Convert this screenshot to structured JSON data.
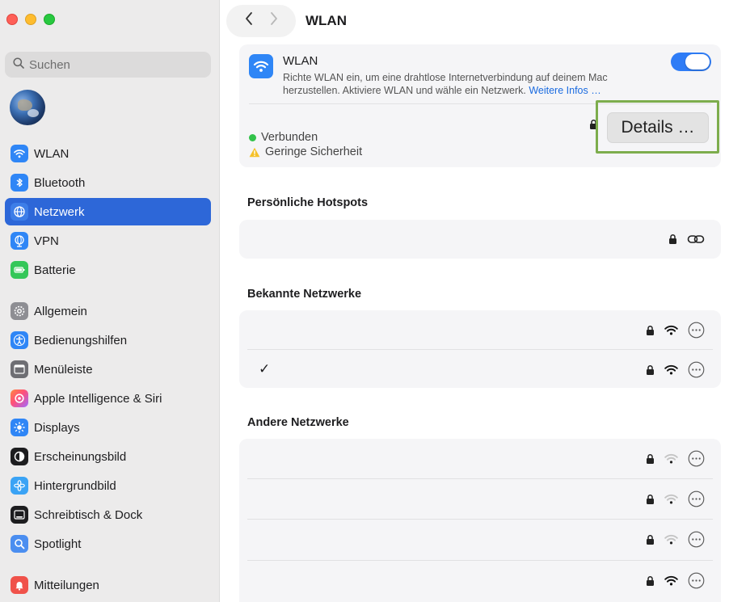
{
  "window": {
    "title": "WLAN"
  },
  "search": {
    "placeholder": "Suchen"
  },
  "sidebar": {
    "items": [
      {
        "label": "WLAN",
        "icon": "wifi-icon",
        "color": "#2f86f6"
      },
      {
        "label": "Bluetooth",
        "icon": "bluetooth-icon",
        "color": "#2f86f6"
      },
      {
        "label": "Netzwerk",
        "icon": "globe-icon",
        "color": "#2f86f6",
        "active": true
      },
      {
        "label": "VPN",
        "icon": "vpn-globe-icon",
        "color": "#2f86f6"
      },
      {
        "label": "Batterie",
        "icon": "battery-icon",
        "color": "#34c759"
      },
      {
        "label": "Allgemein",
        "icon": "gear-icon",
        "color": "#8e8e93"
      },
      {
        "label": "Bedienungshilfen",
        "icon": "accessibility-icon",
        "color": "#2f86f6"
      },
      {
        "label": "Menüleiste",
        "icon": "menubar-icon",
        "color": "#6e6e73"
      },
      {
        "label": "Apple Intelligence & Siri",
        "icon": "siri-icon",
        "color": "#ff6b5e"
      },
      {
        "label": "Displays",
        "icon": "sun-icon",
        "color": "#2f86f6"
      },
      {
        "label": "Erscheinungsbild",
        "icon": "appearance-icon",
        "color": "#1d1d1f"
      },
      {
        "label": "Hintergrundbild",
        "icon": "flower-icon",
        "color": "#3aa3f5"
      },
      {
        "label": "Schreibtisch & Dock",
        "icon": "dock-icon",
        "color": "#1d1d1f"
      },
      {
        "label": "Spotlight",
        "icon": "magnifier-icon",
        "color": "#4b8ef0"
      },
      {
        "label": "Mitteilungen",
        "icon": "bell-icon",
        "color": "#f0524a"
      }
    ]
  },
  "wlan": {
    "title": "WLAN",
    "description": "Richte WLAN ein, um eine drahtlose Internetverbindung auf deinem Mac herzustellen. Aktiviere WLAN und wähle ein Netzwerk.",
    "more_link": "Weitere Infos …",
    "toggle_on": true,
    "status_connected": "Verbunden",
    "status_security": "Geringe Sicherheit",
    "details_button": "Details …"
  },
  "sections": {
    "hotspots": "Persönliche Hotspots",
    "known": "Bekannte Netzwerke",
    "other": "Andere Netzwerke"
  },
  "known_networks": [
    {
      "checked": false,
      "check_mark": ""
    },
    {
      "checked": true,
      "check_mark": "✓"
    }
  ],
  "other_networks": [
    {
      "signal": "weak"
    },
    {
      "signal": "weak"
    },
    {
      "signal": "weak"
    },
    {
      "signal": "strong"
    }
  ]
}
